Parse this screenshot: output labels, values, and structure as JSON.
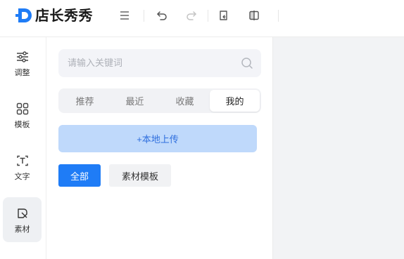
{
  "header": {
    "logo_text": "店长秀秀",
    "tools": [
      {
        "name": "menu-icon"
      },
      {
        "name": "undo-icon"
      },
      {
        "name": "redo-icon"
      },
      {
        "name": "restore-icon"
      },
      {
        "name": "split-compare-icon"
      }
    ]
  },
  "sidebar": {
    "items": [
      {
        "label": "调整",
        "icon": "sliders-icon"
      },
      {
        "label": "模板",
        "icon": "template-grid-icon"
      },
      {
        "label": "文字",
        "icon": "text-icon"
      },
      {
        "label": "素材",
        "icon": "material-shapes-icon",
        "active": true
      }
    ]
  },
  "panel": {
    "search_placeholder": "请输入关键词",
    "tabs": [
      {
        "label": "推荐"
      },
      {
        "label": "最近"
      },
      {
        "label": "收藏"
      },
      {
        "label": "我的",
        "active": true
      }
    ],
    "upload_label": "+本地上传",
    "filters": [
      {
        "label": "全部",
        "active": true
      },
      {
        "label": "素材模板"
      }
    ]
  },
  "colors": {
    "accent": "#1f7cf6",
    "upload_bg": "#bfd9fb",
    "upload_text": "#2f6fde",
    "canvas_bg": "#f2f3f5"
  }
}
